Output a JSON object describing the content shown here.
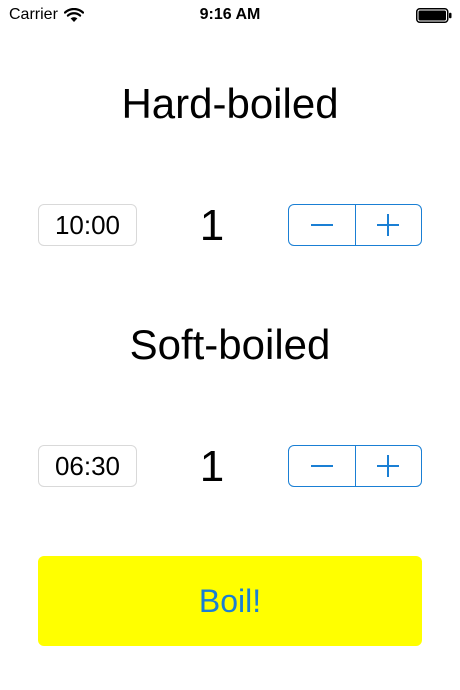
{
  "status_bar": {
    "carrier": "Carrier",
    "time": "9:16 AM",
    "icons": [
      "wifi-icon",
      "battery-icon"
    ]
  },
  "sections": [
    {
      "title": "Hard-boiled",
      "time": "10:00",
      "count": "1",
      "stepper": {
        "decrement_icon": "minus-icon",
        "increment_icon": "plus-icon"
      }
    },
    {
      "title": "Soft-boiled",
      "time": "06:30",
      "count": "1",
      "stepper": {
        "decrement_icon": "minus-icon",
        "increment_icon": "plus-icon"
      }
    }
  ],
  "boil_button": {
    "label": "Boil!"
  },
  "colors": {
    "accent": "#1a7fd4",
    "button_background": "#ffff00",
    "text": "#000000",
    "background": "#ffffff"
  }
}
